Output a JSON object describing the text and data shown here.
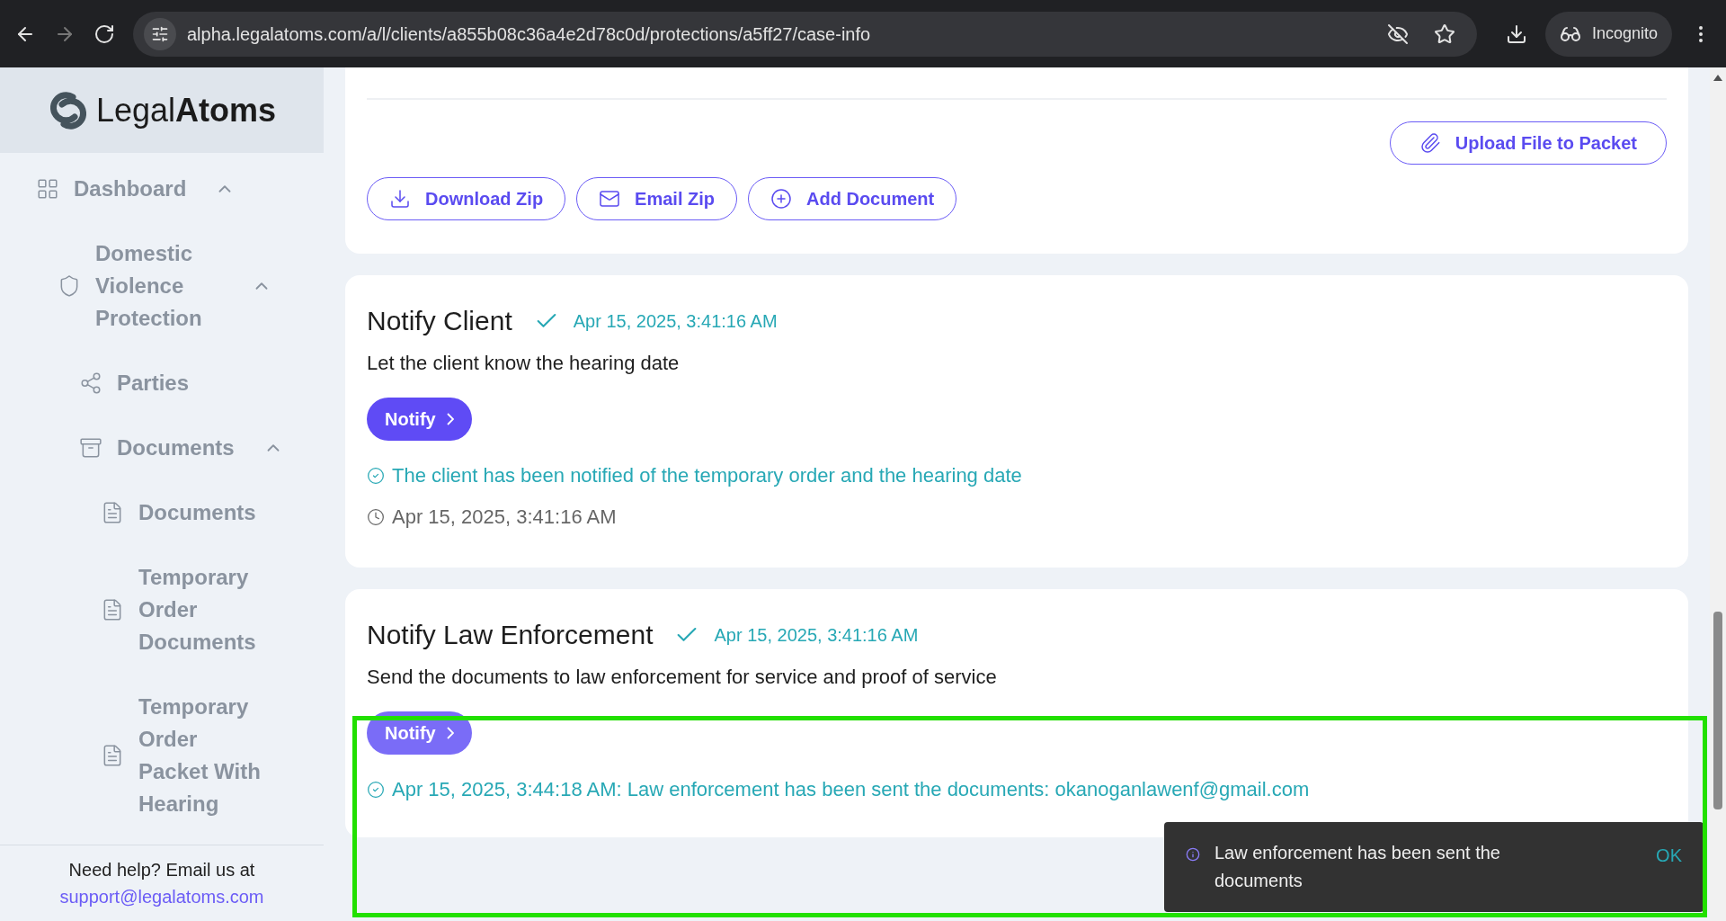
{
  "browser": {
    "url": "alpha.legalatoms.com/a/l/clients/a855b08c36a4e2d78c0d/protections/a5ff27/case-info",
    "profile": "Incognito"
  },
  "sidebar": {
    "logo": {
      "plain": "Legal",
      "bold": "Atoms"
    },
    "items": [
      {
        "label": "Dashboard",
        "expanded": true,
        "children": [
          {
            "label": "Domestic Violence Protection",
            "expanded": true,
            "children": [
              {
                "label": "Parties"
              },
              {
                "label": "Documents",
                "expanded": true,
                "children": [
                  {
                    "label": "Documents"
                  },
                  {
                    "label": "Temporary Order Documents"
                  },
                  {
                    "label": "Temporary Order Packet With Hearing"
                  }
                ]
              }
            ]
          }
        ]
      }
    ],
    "help": "Need help? Email us at",
    "email": "support@legalatoms.com"
  },
  "packet": {
    "upload": "Upload File to Packet",
    "buttons": [
      {
        "label": "Download Zip"
      },
      {
        "label": "Email Zip"
      },
      {
        "label": "Add Document"
      }
    ]
  },
  "tasks": [
    {
      "title": "Notify Client",
      "done": true,
      "date": "Apr 15, 2025, 3:41:16 AM",
      "description": "Let the client know the hearing date",
      "button": "Notify",
      "disabled": false,
      "status": "The client has been notified of the temporary order and the hearing date",
      "time": "Apr 15, 2025, 3:41:16 AM"
    },
    {
      "title": "Notify Law Enforcement",
      "done": true,
      "date": "Apr 15, 2025, 3:41:16 AM",
      "description": "Send the documents to law enforcement for service and proof of service",
      "button": "Notify",
      "disabled": true,
      "status": "Apr 15, 2025, 3:44:18 AM: Law enforcement has been sent the documents: okanoganlawenf@gmail.com"
    }
  ],
  "toast": {
    "message": "Law enforcement has been sent the documents",
    "action": "OK"
  },
  "highlight": true
}
